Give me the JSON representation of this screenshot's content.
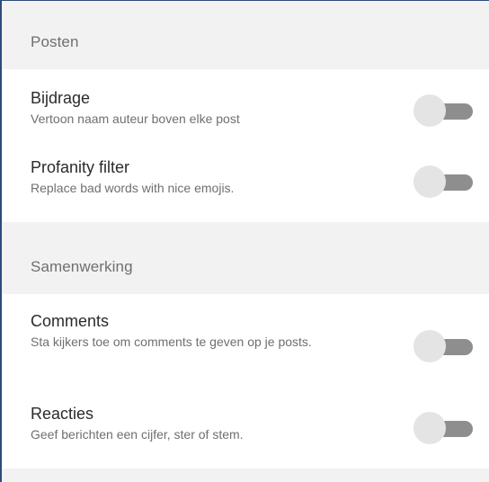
{
  "sections": [
    {
      "title": "Posten",
      "settings": [
        {
          "label": "Bijdrage",
          "description": "Vertoon naam auteur boven elke post",
          "enabled": false
        },
        {
          "label": "Profanity filter",
          "description": "Replace bad words with nice emojis.",
          "enabled": false
        }
      ]
    },
    {
      "title": "Samenwerking",
      "settings": [
        {
          "label": "Comments",
          "description": "Sta kijkers toe om comments te geven op je posts.",
          "enabled": false
        },
        {
          "label": "Reacties",
          "description": "Geef berichten een cijfer, ster of stem.",
          "enabled": false
        }
      ]
    }
  ],
  "colors": {
    "header_bg": "#f2f2f2",
    "toggle_track": "#8e8e8e",
    "toggle_thumb": "#e4e4e4",
    "border": "#2f4a7a"
  }
}
